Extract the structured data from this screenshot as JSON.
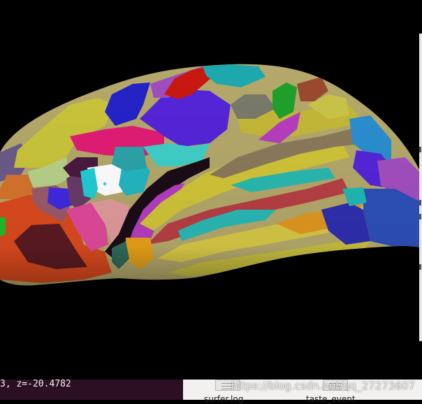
{
  "statusbar": {
    "coordinate_text": "3, z=-20.4782"
  },
  "file_browser": {
    "items": [
      {
        "name": "surfer.log",
        "icon": "text-file-icon"
      },
      {
        "name": "taste_event",
        "icon": "text-file-icon"
      }
    ]
  },
  "watermark": {
    "text": "https://blog.csdn.net/qq_27273607"
  },
  "colors": {
    "viewport_background": "#000000",
    "statusbar_background": "#2c0f22",
    "file_strip_background": "#f2f1ef"
  }
}
